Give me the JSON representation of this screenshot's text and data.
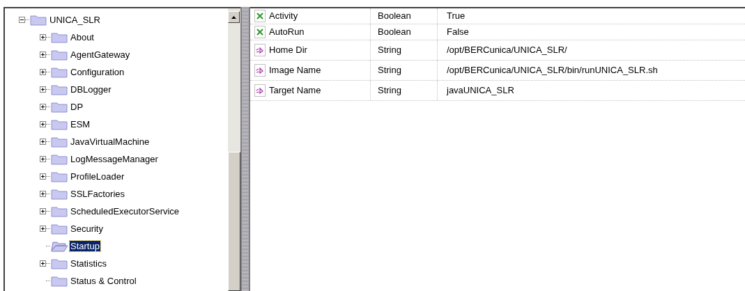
{
  "tree": {
    "root": {
      "label": "UNICA_SLR",
      "expanded": true,
      "selected": false
    },
    "children": [
      {
        "label": "About",
        "has_children": true,
        "selected": false
      },
      {
        "label": "AgentGateway",
        "has_children": true,
        "selected": false
      },
      {
        "label": "Configuration",
        "has_children": true,
        "selected": false
      },
      {
        "label": "DBLogger",
        "has_children": true,
        "selected": false
      },
      {
        "label": "DP",
        "has_children": true,
        "selected": false
      },
      {
        "label": "ESM",
        "has_children": true,
        "selected": false
      },
      {
        "label": "JavaVirtualMachine",
        "has_children": true,
        "selected": false
      },
      {
        "label": "LogMessageManager",
        "has_children": true,
        "selected": false
      },
      {
        "label": "ProfileLoader",
        "has_children": true,
        "selected": false
      },
      {
        "label": "SSLFactories",
        "has_children": true,
        "selected": false
      },
      {
        "label": "ScheduledExecutorService",
        "has_children": true,
        "selected": false
      },
      {
        "label": "Security",
        "has_children": true,
        "selected": false
      },
      {
        "label": "Startup",
        "has_children": false,
        "selected": true
      },
      {
        "label": "Statistics",
        "has_children": true,
        "selected": false
      },
      {
        "label": "Status & Control",
        "has_children": false,
        "selected": false
      }
    ]
  },
  "properties": [
    {
      "kind": "boolean",
      "name": "Activity",
      "type": "Boolean",
      "value": "True"
    },
    {
      "kind": "boolean",
      "name": "AutoRun",
      "type": "Boolean",
      "value": "False"
    },
    {
      "kind": "string",
      "name": "Home Dir",
      "type": "String",
      "value": "/opt/BERCunica/UNICA_SLR/"
    },
    {
      "kind": "string",
      "name": "Image Name",
      "type": "String",
      "value": "/opt/BERCunica/UNICA_SLR/bin/runUNICA_SLR.sh"
    },
    {
      "kind": "string",
      "name": "Target Name",
      "type": "String",
      "value": "javaUNICA_SLR"
    }
  ]
}
